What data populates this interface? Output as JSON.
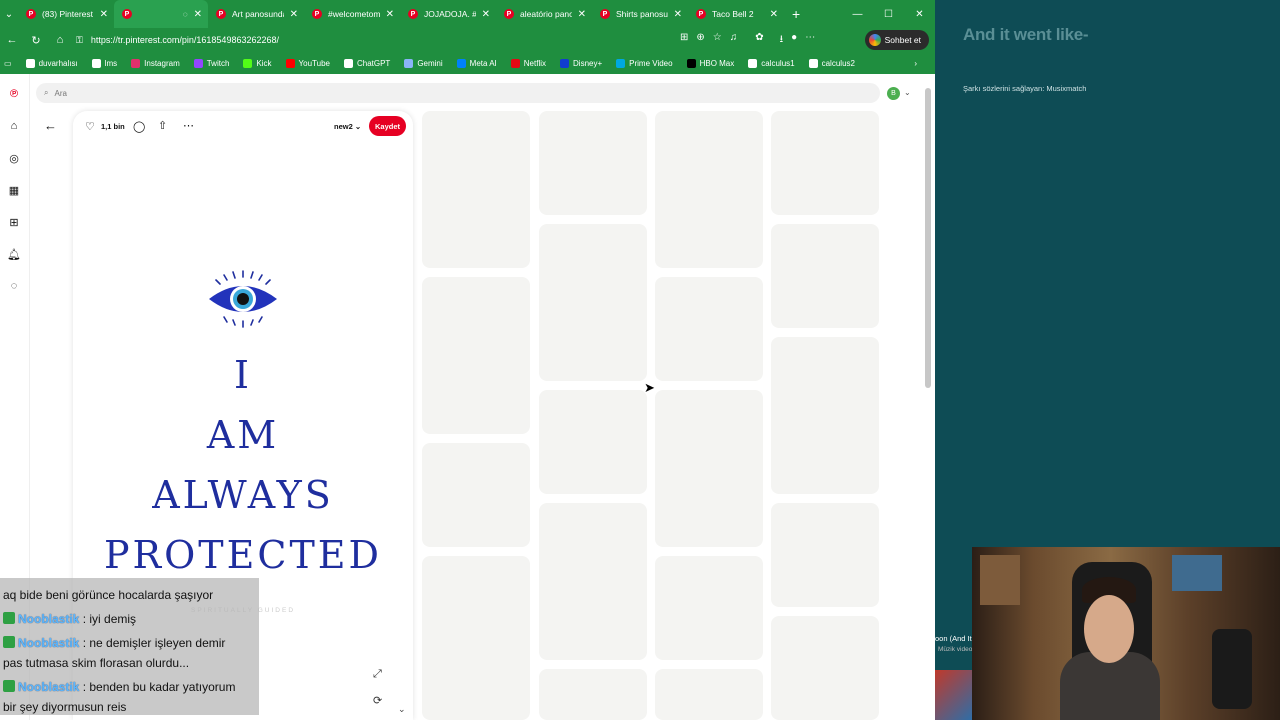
{
  "browser": {
    "tabs": [
      {
        "label": "(83) Pinterest",
        "active": false
      },
      {
        "label": "",
        "active": true
      },
      {
        "label": "Art panosundaki",
        "active": false
      },
      {
        "label": "#welcometomiami",
        "active": false
      },
      {
        "label": "JOJADOJA. #joji",
        "active": false
      },
      {
        "label": "aleatório panos",
        "active": false
      },
      {
        "label": "Shirts panosunda",
        "active": false
      },
      {
        "label": "Taco Bell 2",
        "active": false
      }
    ],
    "url": "https://tr.pinterest.com/pin/1618549863262268/",
    "copilot_label": "Sohbet et",
    "bookmarks": [
      {
        "label": "duvarhalısı",
        "color": "#ffffff"
      },
      {
        "label": "lms",
        "color": "#ffffff"
      },
      {
        "label": "Instagram",
        "color": "#e1306c"
      },
      {
        "label": "Twitch",
        "color": "#9146ff"
      },
      {
        "label": "Kick",
        "color": "#53fc18"
      },
      {
        "label": "YouTube",
        "color": "#ff0000"
      },
      {
        "label": "ChatGPT",
        "color": "#ffffff"
      },
      {
        "label": "Gemini",
        "color": "#8ab4f8"
      },
      {
        "label": "Meta AI",
        "color": "#0081fb"
      },
      {
        "label": "Netflix",
        "color": "#e50914"
      },
      {
        "label": "Disney+",
        "color": "#113ccf"
      },
      {
        "label": "Prime Video",
        "color": "#00a8e1"
      },
      {
        "label": "HBO Max",
        "color": "#000000"
      },
      {
        "label": "calculus1",
        "color": "#ffffff"
      },
      {
        "label": "calculus2",
        "color": "#ffffff"
      }
    ]
  },
  "pinterest": {
    "search_placeholder": "Ara",
    "avatar_letter": "B",
    "likes": "1,1 bin",
    "board": "new2",
    "save_label": "Kaydet",
    "pin_lines": [
      "I",
      "AM",
      "ALWAYS",
      "PROTECTED"
    ],
    "pin_brand": "SPIRITUALLY GUIDED"
  },
  "overlay": {
    "lyric": "And it went like-",
    "lyric_credit": "Şarkı sözlerini sağlayan: Musixmatch",
    "yt_title": "oon (And It",
    "yt_sub": "Müzik video",
    "chat": [
      {
        "user": "",
        "text": "aq bide beni görünce hocalarda şaşıyor"
      },
      {
        "user": "Nooblastik",
        "text": ": iyi demiş"
      },
      {
        "user": "Nooblastik",
        "text": ": ne demişler işleyen demir"
      },
      {
        "user": "",
        "text": "pas tutmasa skim florasan olurdu..."
      },
      {
        "user": "Nooblastik",
        "text": ": benden bu kadar yatıyorum"
      },
      {
        "user": "",
        "text": "bir şey diyormusun reis"
      }
    ]
  },
  "colors": {
    "chrome_green": "#1f8e3f",
    "pinterest_red": "#e60023",
    "pin_text_blue": "#1f2e9e",
    "panel_teal": "#0e4c55"
  }
}
